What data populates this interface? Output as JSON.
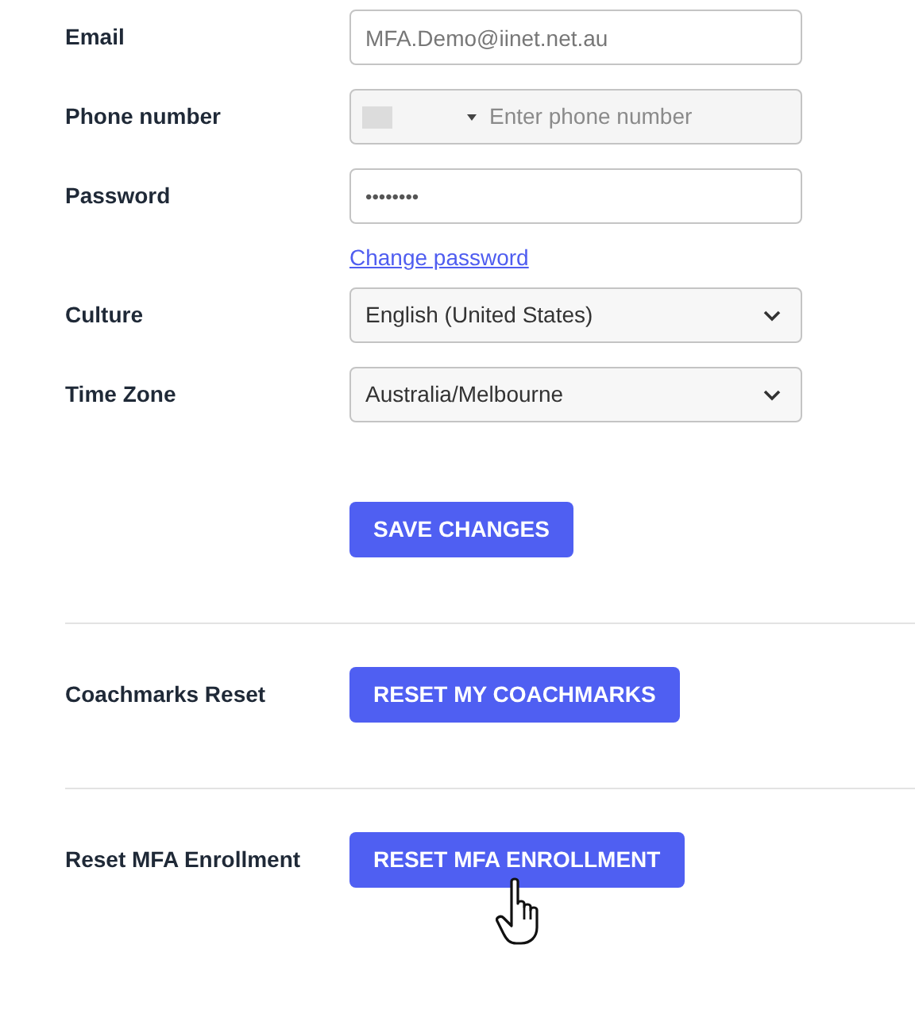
{
  "fields": [
    {
      "kind": "text",
      "label": "Email",
      "value": "MFA.Demo@iinet.net.au"
    },
    {
      "kind": "phone",
      "label": "Phone number",
      "placeholder": "Enter phone number",
      "disabled": true
    },
    {
      "kind": "password",
      "label": "Password",
      "value": "••••••••",
      "link": "Change password"
    },
    {
      "kind": "select",
      "label": "Culture",
      "value": "English (United States)"
    },
    {
      "kind": "select",
      "label": "Time Zone",
      "value": "Australia/Melbourne"
    }
  ],
  "save_button": "SAVE CHANGES",
  "sections": [
    {
      "label": "Coachmarks Reset",
      "button": "RESET MY COACHMARKS"
    },
    {
      "label": "Reset MFA Enrollment",
      "button": "RESET MFA ENROLLMENT",
      "hovered": true
    }
  ]
}
